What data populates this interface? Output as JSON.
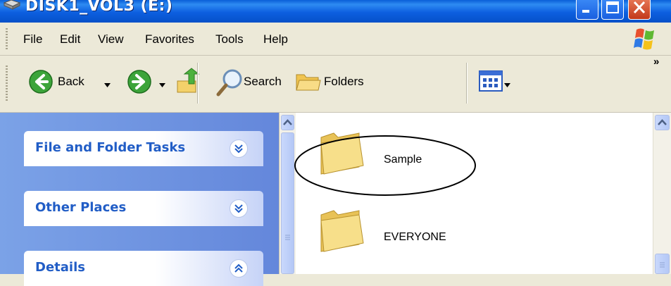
{
  "window": {
    "title": "DISK1_VOL3 (E:)"
  },
  "menu": {
    "items": [
      "File",
      "Edit",
      "View",
      "Favorites",
      "Tools",
      "Help"
    ]
  },
  "toolbar": {
    "back_label": "Back",
    "search_label": "Search",
    "folders_label": "Folders",
    "overflow": "»"
  },
  "taskpane": {
    "panels": [
      {
        "title": "File and Folder Tasks",
        "state": "collapsed"
      },
      {
        "title": "Other Places",
        "state": "collapsed"
      },
      {
        "title": "Details",
        "state": "expanded"
      }
    ]
  },
  "files": [
    {
      "name": "Sample",
      "type": "folder",
      "highlighted": true
    },
    {
      "name": "EVERYONE",
      "type": "folder",
      "highlighted": false
    }
  ],
  "colors": {
    "titlebar": "#0a5fd8",
    "taskpane": "#7ba2e7",
    "panel_title": "#215dc6"
  }
}
